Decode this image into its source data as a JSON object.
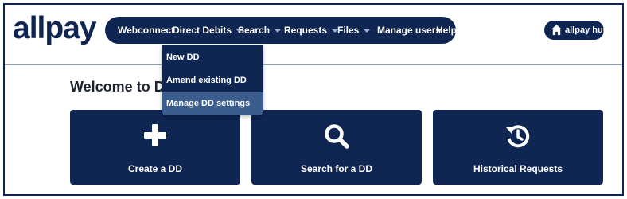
{
  "brand": {
    "logo_text": "allpay"
  },
  "nav": {
    "items": [
      {
        "label": "Webconnect"
      },
      {
        "label": "Direct Debits"
      },
      {
        "label": "Search"
      },
      {
        "label": "Requests"
      },
      {
        "label": "Files"
      },
      {
        "label": "Manage users"
      },
      {
        "label": "Help"
      }
    ],
    "hub_button": {
      "label": "allpay hub",
      "icon": "home-icon"
    }
  },
  "dropdown": {
    "parent": "Direct Debits",
    "items": [
      {
        "label": "New DD"
      },
      {
        "label": "Amend existing DD"
      },
      {
        "label": "Manage DD settings",
        "highlighted": true
      }
    ]
  },
  "main": {
    "welcome_text": "Welcome to Direct",
    "tiles": [
      {
        "label": "Create a DD",
        "icon": "plus-icon"
      },
      {
        "label": "Search for a DD",
        "icon": "search-icon"
      },
      {
        "label": "Historical Requests",
        "icon": "history-icon"
      }
    ]
  },
  "colors": {
    "navy": "#0f2552",
    "highlight": "#3b5d8e",
    "divider": "#8a9ab6",
    "text_dark": "#1b2430"
  }
}
